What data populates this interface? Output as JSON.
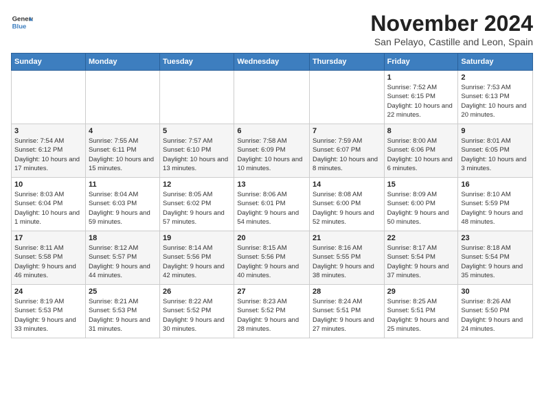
{
  "header": {
    "logo_line1": "General",
    "logo_line2": "Blue",
    "month_title": "November 2024",
    "location": "San Pelayo, Castille and Leon, Spain"
  },
  "calendar": {
    "days_of_week": [
      "Sunday",
      "Monday",
      "Tuesday",
      "Wednesday",
      "Thursday",
      "Friday",
      "Saturday"
    ],
    "weeks": [
      [
        {
          "day": "",
          "info": ""
        },
        {
          "day": "",
          "info": ""
        },
        {
          "day": "",
          "info": ""
        },
        {
          "day": "",
          "info": ""
        },
        {
          "day": "",
          "info": ""
        },
        {
          "day": "1",
          "info": "Sunrise: 7:52 AM\nSunset: 6:15 PM\nDaylight: 10 hours and 22 minutes."
        },
        {
          "day": "2",
          "info": "Sunrise: 7:53 AM\nSunset: 6:13 PM\nDaylight: 10 hours and 20 minutes."
        }
      ],
      [
        {
          "day": "3",
          "info": "Sunrise: 7:54 AM\nSunset: 6:12 PM\nDaylight: 10 hours and 17 minutes."
        },
        {
          "day": "4",
          "info": "Sunrise: 7:55 AM\nSunset: 6:11 PM\nDaylight: 10 hours and 15 minutes."
        },
        {
          "day": "5",
          "info": "Sunrise: 7:57 AM\nSunset: 6:10 PM\nDaylight: 10 hours and 13 minutes."
        },
        {
          "day": "6",
          "info": "Sunrise: 7:58 AM\nSunset: 6:09 PM\nDaylight: 10 hours and 10 minutes."
        },
        {
          "day": "7",
          "info": "Sunrise: 7:59 AM\nSunset: 6:07 PM\nDaylight: 10 hours and 8 minutes."
        },
        {
          "day": "8",
          "info": "Sunrise: 8:00 AM\nSunset: 6:06 PM\nDaylight: 10 hours and 6 minutes."
        },
        {
          "day": "9",
          "info": "Sunrise: 8:01 AM\nSunset: 6:05 PM\nDaylight: 10 hours and 3 minutes."
        }
      ],
      [
        {
          "day": "10",
          "info": "Sunrise: 8:03 AM\nSunset: 6:04 PM\nDaylight: 10 hours and 1 minute."
        },
        {
          "day": "11",
          "info": "Sunrise: 8:04 AM\nSunset: 6:03 PM\nDaylight: 9 hours and 59 minutes."
        },
        {
          "day": "12",
          "info": "Sunrise: 8:05 AM\nSunset: 6:02 PM\nDaylight: 9 hours and 57 minutes."
        },
        {
          "day": "13",
          "info": "Sunrise: 8:06 AM\nSunset: 6:01 PM\nDaylight: 9 hours and 54 minutes."
        },
        {
          "day": "14",
          "info": "Sunrise: 8:08 AM\nSunset: 6:00 PM\nDaylight: 9 hours and 52 minutes."
        },
        {
          "day": "15",
          "info": "Sunrise: 8:09 AM\nSunset: 6:00 PM\nDaylight: 9 hours and 50 minutes."
        },
        {
          "day": "16",
          "info": "Sunrise: 8:10 AM\nSunset: 5:59 PM\nDaylight: 9 hours and 48 minutes."
        }
      ],
      [
        {
          "day": "17",
          "info": "Sunrise: 8:11 AM\nSunset: 5:58 PM\nDaylight: 9 hours and 46 minutes."
        },
        {
          "day": "18",
          "info": "Sunrise: 8:12 AM\nSunset: 5:57 PM\nDaylight: 9 hours and 44 minutes."
        },
        {
          "day": "19",
          "info": "Sunrise: 8:14 AM\nSunset: 5:56 PM\nDaylight: 9 hours and 42 minutes."
        },
        {
          "day": "20",
          "info": "Sunrise: 8:15 AM\nSunset: 5:56 PM\nDaylight: 9 hours and 40 minutes."
        },
        {
          "day": "21",
          "info": "Sunrise: 8:16 AM\nSunset: 5:55 PM\nDaylight: 9 hours and 38 minutes."
        },
        {
          "day": "22",
          "info": "Sunrise: 8:17 AM\nSunset: 5:54 PM\nDaylight: 9 hours and 37 minutes."
        },
        {
          "day": "23",
          "info": "Sunrise: 8:18 AM\nSunset: 5:54 PM\nDaylight: 9 hours and 35 minutes."
        }
      ],
      [
        {
          "day": "24",
          "info": "Sunrise: 8:19 AM\nSunset: 5:53 PM\nDaylight: 9 hours and 33 minutes."
        },
        {
          "day": "25",
          "info": "Sunrise: 8:21 AM\nSunset: 5:53 PM\nDaylight: 9 hours and 31 minutes."
        },
        {
          "day": "26",
          "info": "Sunrise: 8:22 AM\nSunset: 5:52 PM\nDaylight: 9 hours and 30 minutes."
        },
        {
          "day": "27",
          "info": "Sunrise: 8:23 AM\nSunset: 5:52 PM\nDaylight: 9 hours and 28 minutes."
        },
        {
          "day": "28",
          "info": "Sunrise: 8:24 AM\nSunset: 5:51 PM\nDaylight: 9 hours and 27 minutes."
        },
        {
          "day": "29",
          "info": "Sunrise: 8:25 AM\nSunset: 5:51 PM\nDaylight: 9 hours and 25 minutes."
        },
        {
          "day": "30",
          "info": "Sunrise: 8:26 AM\nSunset: 5:50 PM\nDaylight: 9 hours and 24 minutes."
        }
      ]
    ]
  }
}
